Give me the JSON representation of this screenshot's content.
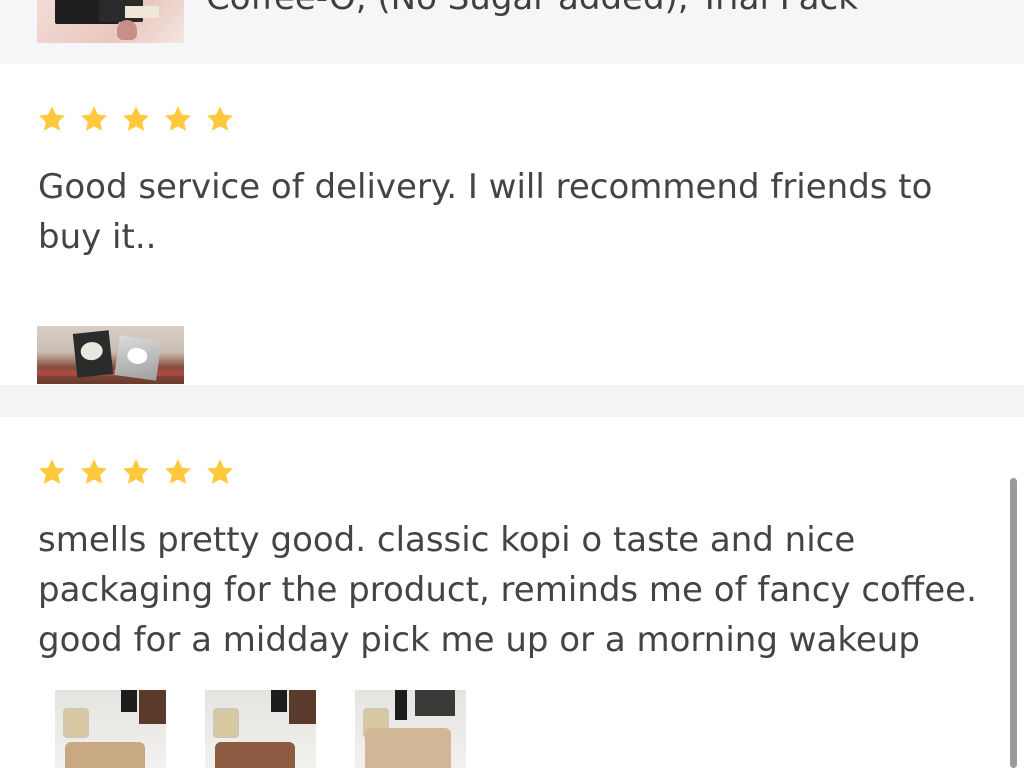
{
  "product": {
    "title": "Coffee-O, (No Sugar added), Trial Pack"
  },
  "reviews": [
    {
      "rating": 5,
      "text": "Good service of delivery. I will recommend friends to buy it..",
      "photo_count": 1
    },
    {
      "rating": 5,
      "text": "smells pretty good. classic kopi o taste and nice packaging for the product, reminds me of fancy coffee. good for a midday pick me up or a morning wakeup",
      "photo_count": 3
    }
  ],
  "colors": {
    "star": "#FFC83D",
    "text": "#444444",
    "band": "#F4F4F6",
    "scrollbar": "#9A9A9A"
  },
  "icons": {
    "rating": "star-icon"
  }
}
